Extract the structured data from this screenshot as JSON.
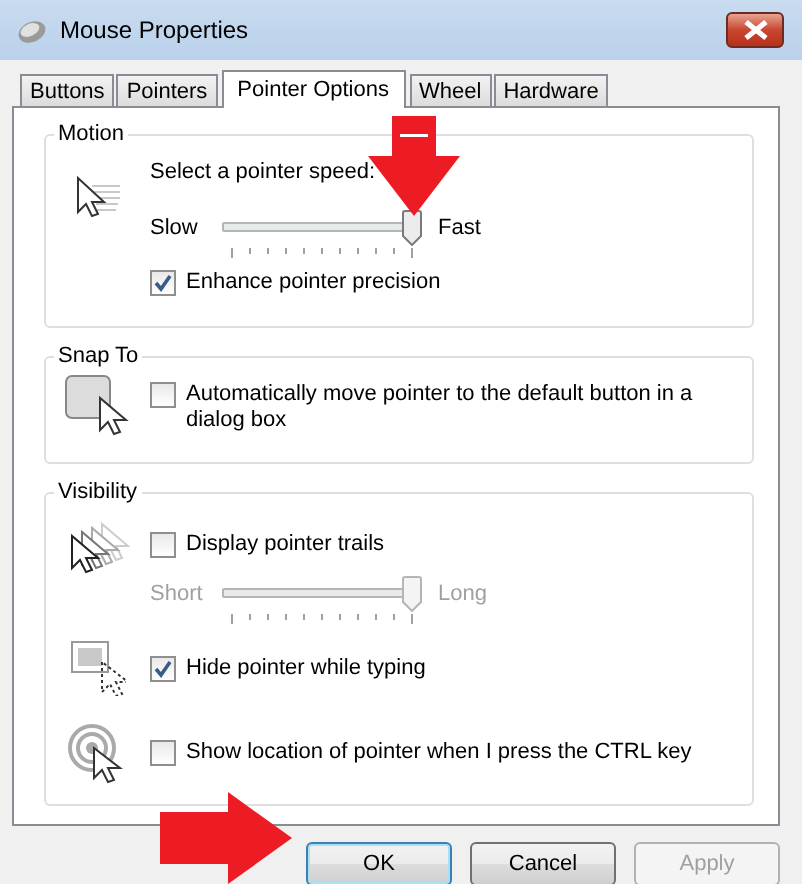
{
  "window": {
    "title": "Mouse Properties"
  },
  "tabs": [
    {
      "label": "Buttons",
      "selected": false
    },
    {
      "label": "Pointers",
      "selected": false
    },
    {
      "label": "Pointer Options",
      "selected": true
    },
    {
      "label": "Wheel",
      "selected": false
    },
    {
      "label": "Hardware",
      "selected": false
    }
  ],
  "groups": [
    {
      "title": "Motion",
      "rows": [
        {
          "kind": "label",
          "text": "Select a pointer speed:"
        },
        {
          "kind": "slider",
          "min_label": "Slow",
          "max_label": "Fast",
          "level": 0.95,
          "disabled": false
        },
        {
          "kind": "checkbox",
          "label": "Enhance pointer precision",
          "checked": true
        }
      ]
    },
    {
      "title": "Snap To",
      "rows": [
        {
          "kind": "checkbox",
          "label": "Automatically move pointer to the default button in a dialog box",
          "checked": false
        }
      ]
    },
    {
      "title": "Visibility",
      "rows": [
        {
          "kind": "checkbox",
          "label": "Display pointer trails",
          "checked": false
        },
        {
          "kind": "slider",
          "min_label": "Short",
          "max_label": "Long",
          "level": 0.95,
          "disabled": true
        },
        {
          "kind": "checkbox",
          "label": "Hide pointer while typing",
          "checked": true
        },
        {
          "kind": "checkbox",
          "label": "Show location of pointer when I press the CTRL key",
          "checked": false
        }
      ]
    }
  ],
  "buttons": [
    {
      "label": "OK",
      "default": true,
      "disabled": false
    },
    {
      "label": "Cancel",
      "default": false,
      "disabled": false
    },
    {
      "label": "Apply",
      "default": false,
      "disabled": true
    }
  ]
}
